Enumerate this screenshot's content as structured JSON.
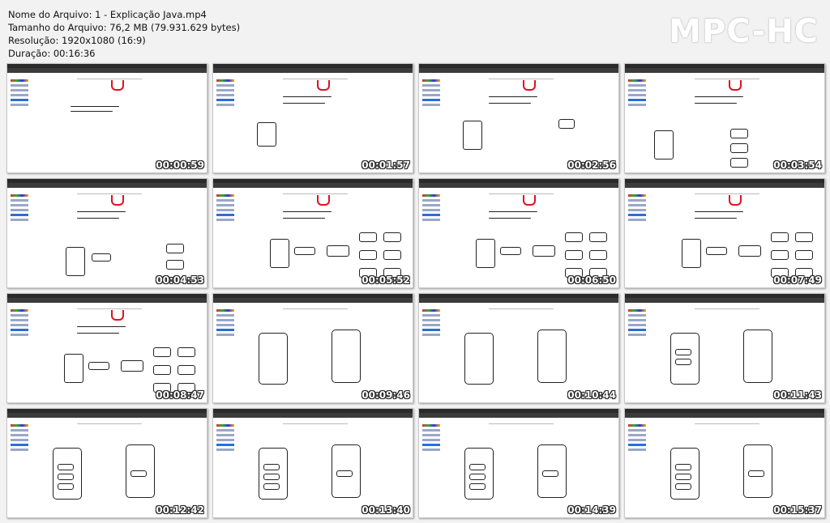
{
  "file_info": {
    "name": "Nome do Arquivo: 1 - Explicação Java.mp4",
    "size": "Tamanho do Arquivo: 76,2 MB (79.931.629 bytes)",
    "resolution": "Resolução: 1920x1080 (16:9)",
    "duration": "Duração: 00:16:36"
  },
  "logo": "MPC-HC",
  "thumbnails": [
    {
      "time": "00:00:59",
      "scene": "intro"
    },
    {
      "time": "00:01:57",
      "scene": "box1"
    },
    {
      "time": "00:02:56",
      "scene": "box2"
    },
    {
      "time": "00:03:54",
      "scene": "box3"
    },
    {
      "time": "00:04:53",
      "scene": "flow1"
    },
    {
      "time": "00:05:52",
      "scene": "flow2"
    },
    {
      "time": "00:06:50",
      "scene": "flow2"
    },
    {
      "time": "00:07:49",
      "scene": "flow2"
    },
    {
      "time": "00:08:47",
      "scene": "flow3"
    },
    {
      "time": "00:09:46",
      "scene": "panels"
    },
    {
      "time": "00:10:44",
      "scene": "panels"
    },
    {
      "time": "00:11:43",
      "scene": "panels2"
    },
    {
      "time": "00:12:42",
      "scene": "panels3"
    },
    {
      "time": "00:13:40",
      "scene": "panels3"
    },
    {
      "time": "00:14:39",
      "scene": "panels3"
    },
    {
      "time": "00:15:37",
      "scene": "panels3"
    }
  ]
}
